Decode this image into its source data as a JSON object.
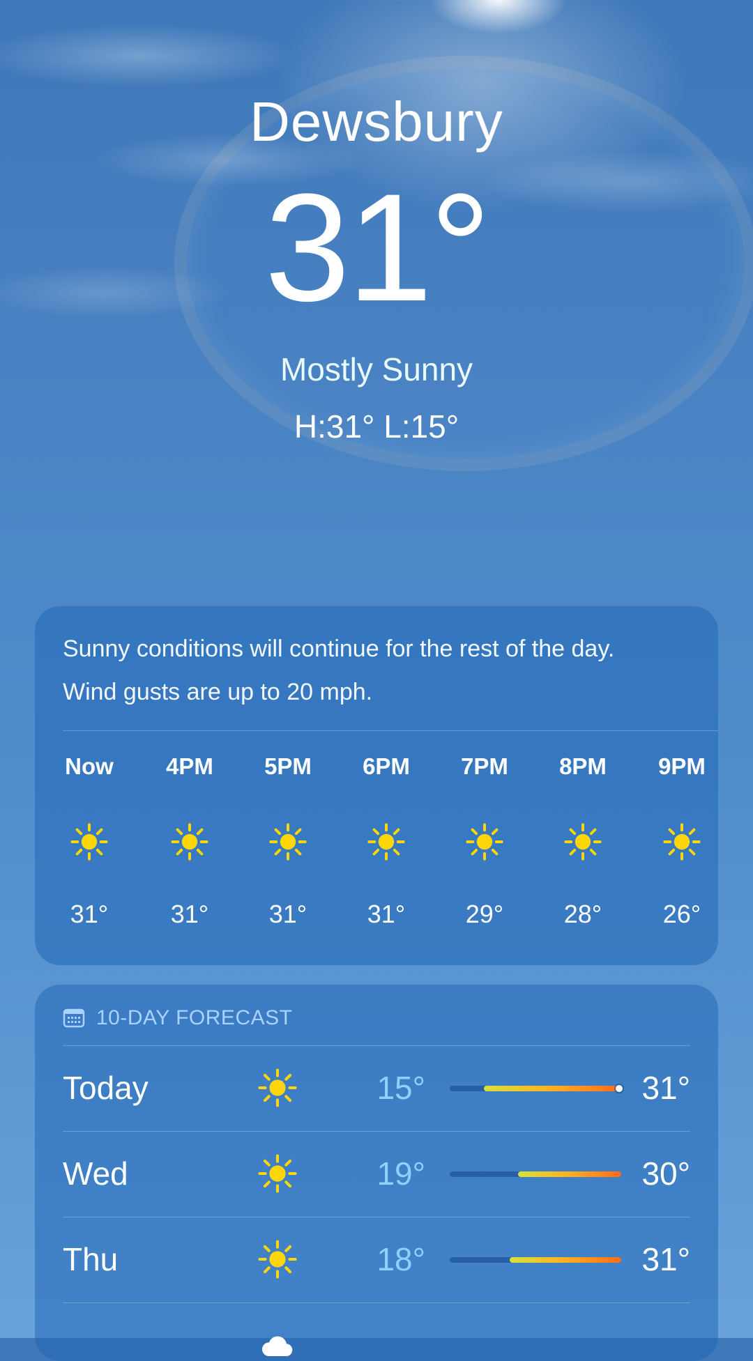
{
  "header": {
    "city": "Dewsbury",
    "temperature": "31°",
    "condition": "Mostly Sunny",
    "high_low": "H:31°  L:15°"
  },
  "hourly": {
    "summary_line1": "Sunny conditions will continue for the rest of the day.",
    "summary_line2": "Wind gusts are up to 20 mph.",
    "hours": [
      {
        "label": "Now",
        "icon": "sun-icon",
        "temp": "31°"
      },
      {
        "label": "4PM",
        "icon": "sun-icon",
        "temp": "31°"
      },
      {
        "label": "5PM",
        "icon": "sun-icon",
        "temp": "31°"
      },
      {
        "label": "6PM",
        "icon": "sun-icon",
        "temp": "31°"
      },
      {
        "label": "7PM",
        "icon": "sun-icon",
        "temp": "29°"
      },
      {
        "label": "8PM",
        "icon": "sun-icon",
        "temp": "28°"
      },
      {
        "label": "9PM",
        "icon": "sun-icon",
        "temp": "26°"
      }
    ]
  },
  "forecast": {
    "title": "10-DAY FORECAST",
    "title_icon": "calendar-icon",
    "days": [
      {
        "day": "Today",
        "icon": "sun-icon",
        "low": "15°",
        "high": "31°",
        "range_start": 0.2,
        "range_end": 1.0,
        "current_marker": true
      },
      {
        "day": "Wed",
        "icon": "sun-icon",
        "low": "19°",
        "high": "30°",
        "range_start": 0.4,
        "range_end": 1.0,
        "current_marker": false
      },
      {
        "day": "Thu",
        "icon": "sun-icon",
        "low": "18°",
        "high": "31°",
        "range_start": 0.35,
        "range_end": 1.0,
        "current_marker": false
      },
      {
        "day": "",
        "icon": "cloud-icon",
        "low": "",
        "high": "",
        "range_start": 0,
        "range_end": 0,
        "current_marker": false
      }
    ]
  },
  "colors": {
    "sun": "#ffd60a",
    "low_temp": "#8fd0ff",
    "range_start": "#d8e23a",
    "range_mid": "#ffb020",
    "range_end": "#ff6a1a"
  }
}
